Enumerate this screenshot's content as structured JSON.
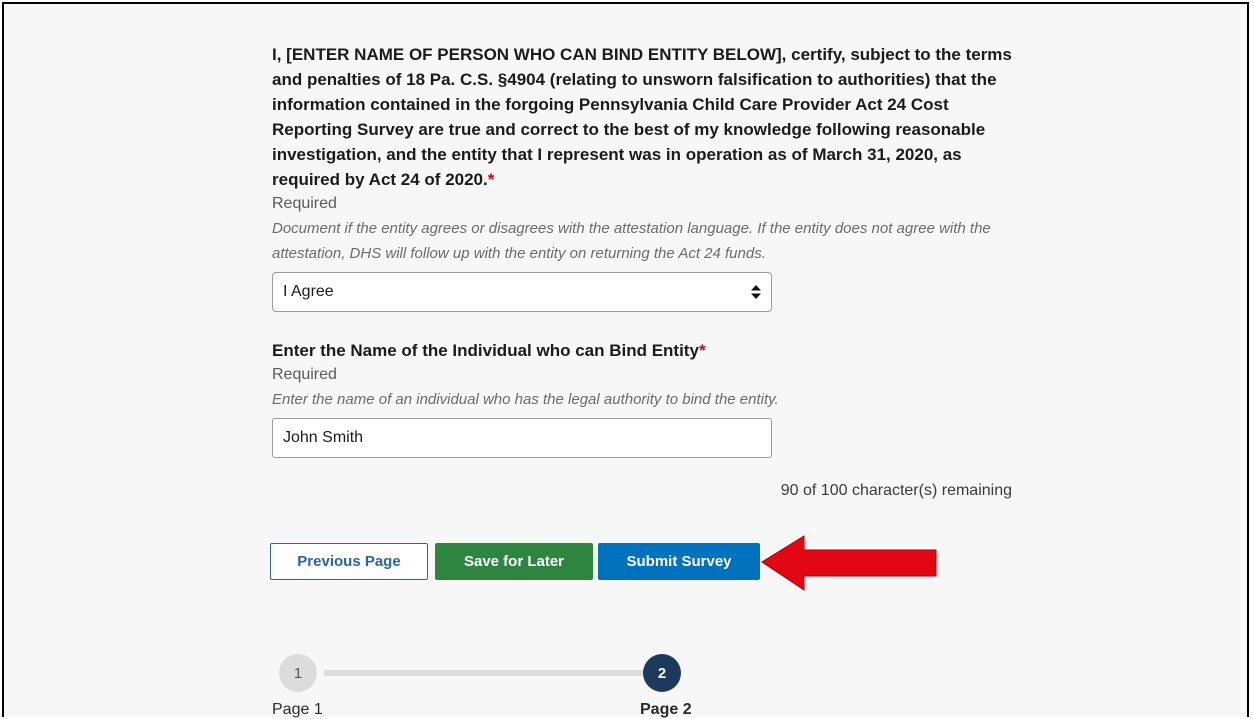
{
  "attestation": {
    "question": "I, [ENTER NAME OF PERSON WHO CAN BIND ENTITY BELOW], certify, subject to the terms and penalties of 18 Pa. C.S. §4904 (relating to unsworn falsification to authorities) that the information contained in the forgoing Pennsylvania Child Care Provider Act 24 Cost Reporting Survey are true and correct to the best of my knowledge following reasonable investigation, and the entity that I represent was in operation as of March 31, 2020, as required by Act 24 of 2020.",
    "required_mark": "*",
    "required_label": "Required",
    "hint": "Document if the entity agrees or disagrees with the attestation language. If the entity does not agree with the attestation, DHS will follow up with the entity on returning the Act 24 funds.",
    "selected_value": "I Agree"
  },
  "bind_name": {
    "label": "Enter the Name of the Individual who can Bind Entity",
    "required_mark": "*",
    "required_label": "Required",
    "hint": "Enter the name of an individual who has the legal authority to bind the entity.",
    "value": "John Smith",
    "counter": "90 of 100 character(s) remaining"
  },
  "buttons": {
    "previous": "Previous Page",
    "save": "Save for Later",
    "submit": "Submit Survey"
  },
  "progress": {
    "steps": [
      {
        "number": "1",
        "label": "Page 1"
      },
      {
        "number": "2",
        "label": "Page 2"
      }
    ]
  },
  "colors": {
    "arrow": "#e30613",
    "save_green": "#2e8540",
    "submit_blue": "#0071bc",
    "active_step": "#1b3a5c"
  },
  "icons": {
    "select_arrows": "sort-arrows-icon",
    "pointer": "red-arrow-icon"
  }
}
